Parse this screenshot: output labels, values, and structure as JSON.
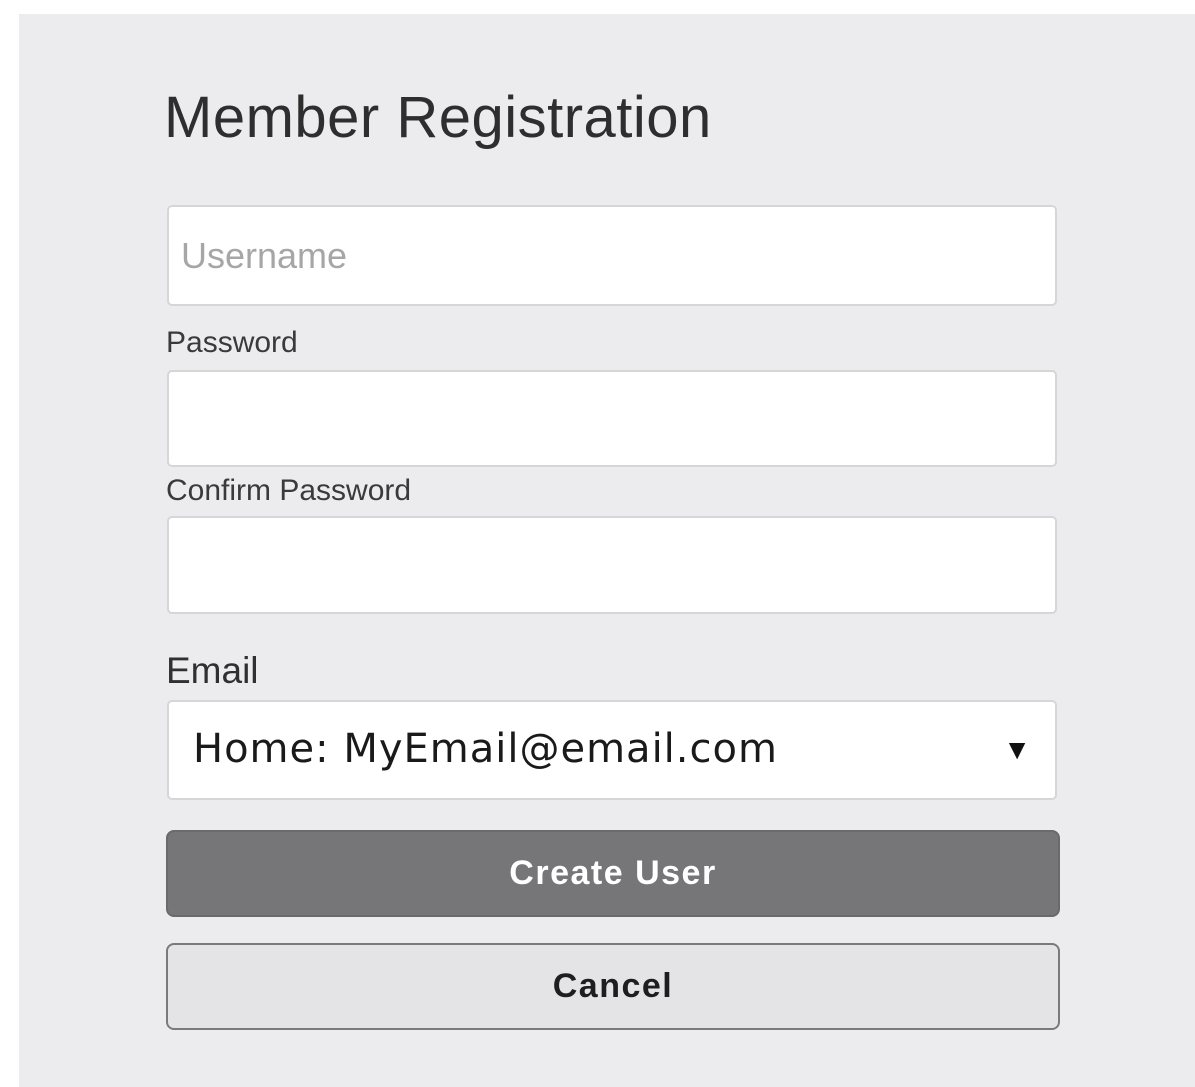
{
  "form": {
    "title": "Member Registration",
    "username": {
      "placeholder": "Username",
      "value": ""
    },
    "password": {
      "label": "Password",
      "value": ""
    },
    "confirm_password": {
      "label": "Confirm Password",
      "value": ""
    },
    "email": {
      "label": "Email",
      "selected": "Home: MyEmail@email.com",
      "arrow": "▼"
    },
    "create_label": "Create User",
    "cancel_label": "Cancel"
  },
  "colors": {
    "panel_background": "#ececee",
    "primary_button": "#767678",
    "secondary_button": "#e4e4e6"
  },
  "icons": {
    "dropdown": "chevron-down-icon"
  }
}
